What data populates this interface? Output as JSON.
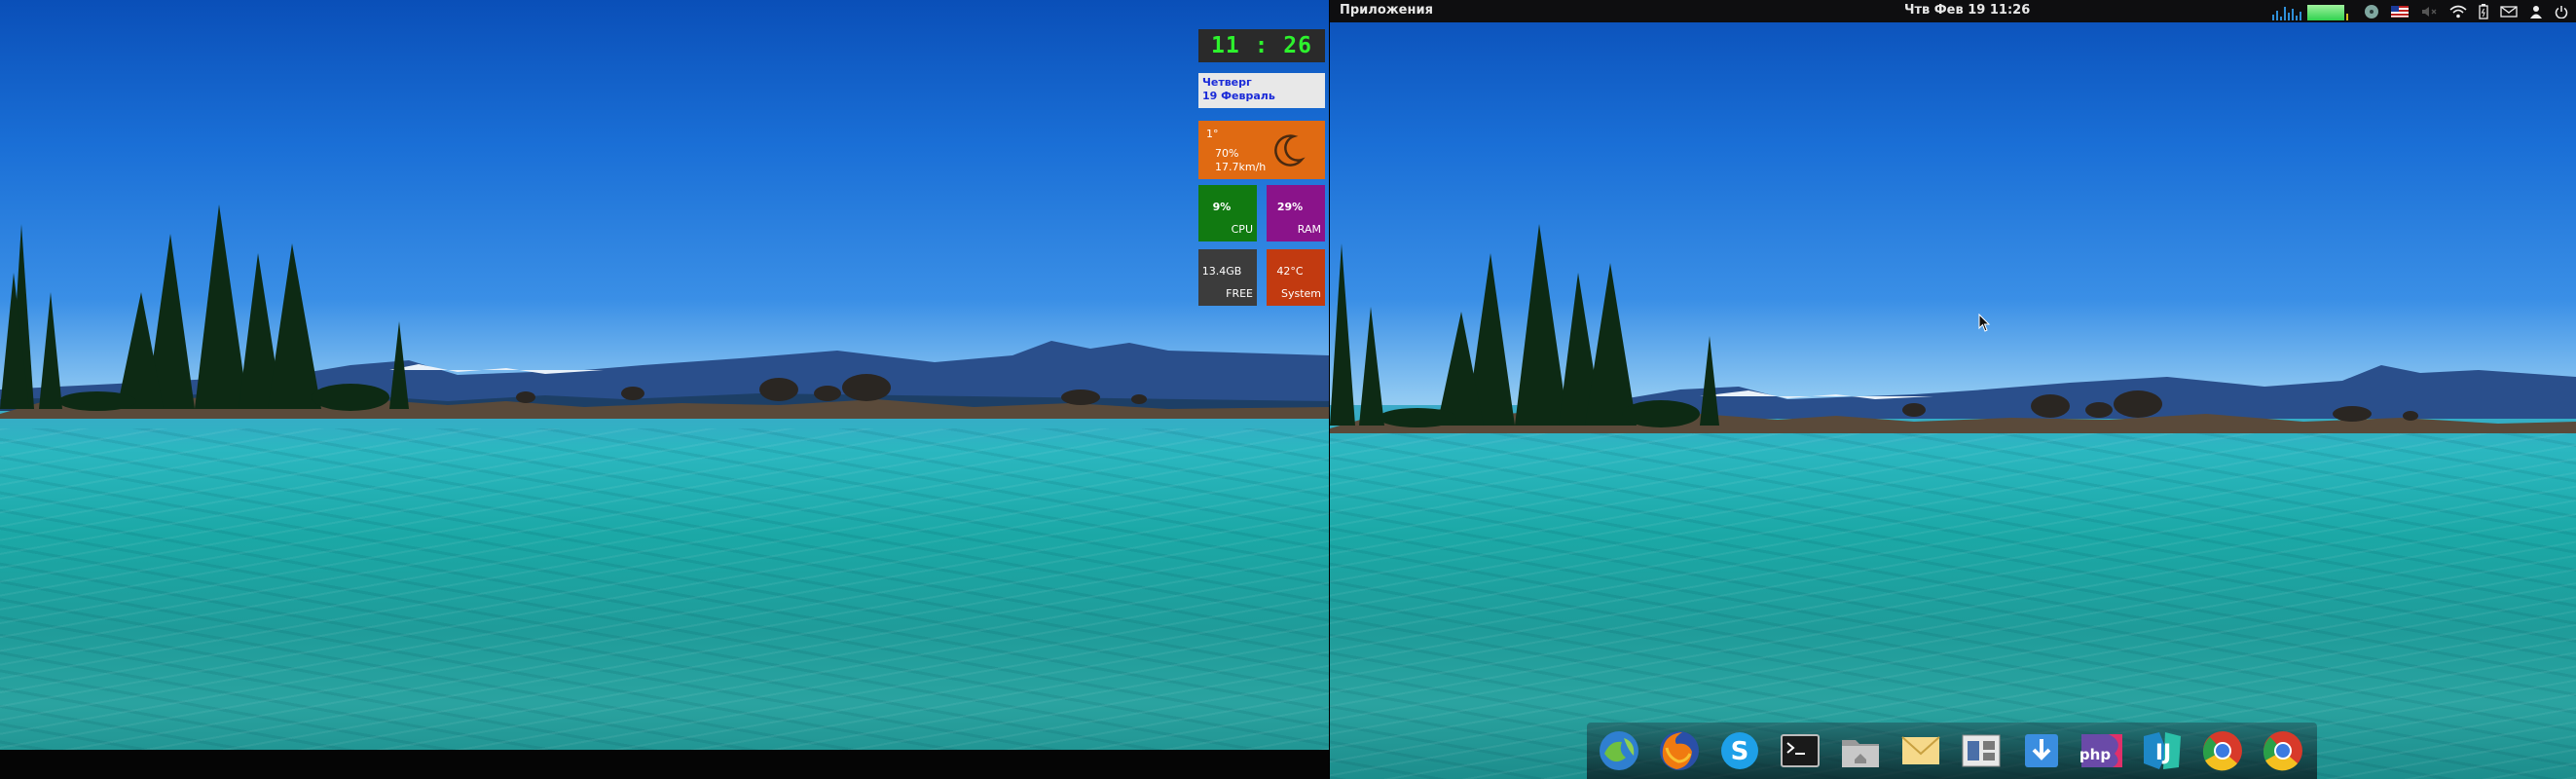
{
  "desktop": {
    "conky": {
      "clock": "11 : 26",
      "date_line1": "Четверг",
      "date_line2": "19 Февраль",
      "weather": {
        "temp": "1°",
        "humidity": "70%",
        "wind": "17.7km/h",
        "icon": "moon-icon"
      },
      "cpu": {
        "value": "9%",
        "label": "CPU"
      },
      "ram": {
        "value": "29%",
        "label": "RAM"
      },
      "disk": {
        "value": "13.4GB",
        "label": "FREE"
      },
      "temp": {
        "value": "42°C",
        "label": "System"
      }
    }
  },
  "top_panel": {
    "apps_label": "Приложения",
    "clock": "Чтв Фев 19 11:26",
    "indicators": [
      "system-monitor-graph",
      "disk-icon",
      "us-flag-icon",
      "volume-muted-icon",
      "wifi-icon",
      "battery-icon",
      "mail-icon",
      "user-icon",
      "power-icon"
    ]
  },
  "dock": {
    "items": [
      "pantheon-icon",
      "firefox-icon",
      "skype-icon",
      "terminal-icon",
      "files-icon",
      "mail-icon",
      "multitasking-icon",
      "downloads-icon",
      "phpstorm-icon",
      "intellij-icon",
      "chrome-icon",
      "chrome-icon"
    ]
  },
  "colors": {
    "clock_green": "#2df22d",
    "weather_orange": "#e06a12",
    "cpu_green": "#117a11",
    "ram_purple": "#8a138a",
    "disk_gray": "#3c3c3c",
    "temp_red": "#c23a10"
  }
}
